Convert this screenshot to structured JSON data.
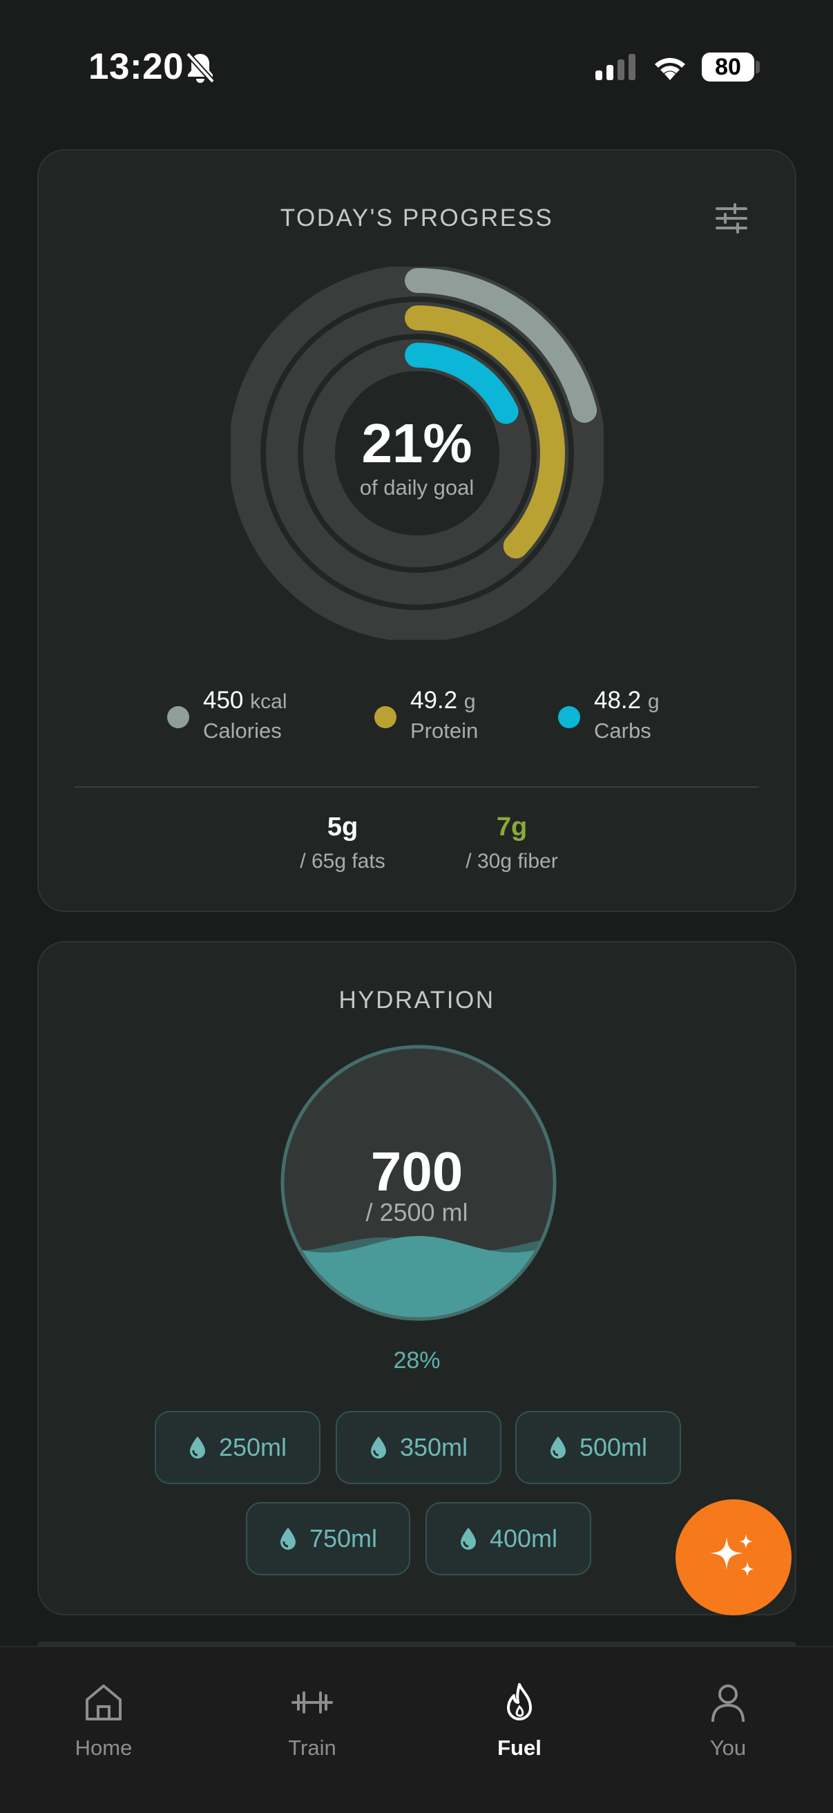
{
  "status_bar": {
    "time": "13:20",
    "battery": "80"
  },
  "progress": {
    "title": "TODAY'S PROGRESS",
    "percent": "21%",
    "subtitle": "of daily goal",
    "rings": [
      {
        "name": "Calories",
        "fraction": 0.21,
        "color": "#8f9e99"
      },
      {
        "name": "Protein",
        "fraction": 0.37,
        "color": "#baa232"
      },
      {
        "name": "Carbs",
        "fraction": 0.18,
        "color": "#0bb6d6"
      }
    ],
    "legend": [
      {
        "value": "450",
        "unit": "kcal",
        "label": "Calories",
        "color": "#8f9e99"
      },
      {
        "value": "49.2",
        "unit": "g",
        "label": "Protein",
        "color": "#baa232"
      },
      {
        "value": "48.2",
        "unit": "g",
        "label": "Carbs",
        "color": "#0bb6d6"
      }
    ],
    "fats": {
      "value": "5g",
      "label": "/ 65g fats"
    },
    "fiber": {
      "value": "7g",
      "label": "/ 30g fiber"
    }
  },
  "hydration": {
    "title": "HYDRATION",
    "amount": "700",
    "goal": "/ 2500 ml",
    "percent": "28%",
    "fill_fraction": 0.28,
    "buttons": [
      "250ml",
      "350ml",
      "500ml",
      "750ml",
      "400ml"
    ]
  },
  "tabs": [
    {
      "label": "Home",
      "icon": "home-icon",
      "active": false
    },
    {
      "label": "Train",
      "icon": "dumbbell-icon",
      "active": false
    },
    {
      "label": "Fuel",
      "icon": "flame-icon",
      "active": true
    },
    {
      "label": "You",
      "icon": "person-icon",
      "active": false
    }
  ],
  "colors": {
    "accent": "#f6791b",
    "water": "#4a9a9a",
    "fiber": "#8aaa38"
  }
}
